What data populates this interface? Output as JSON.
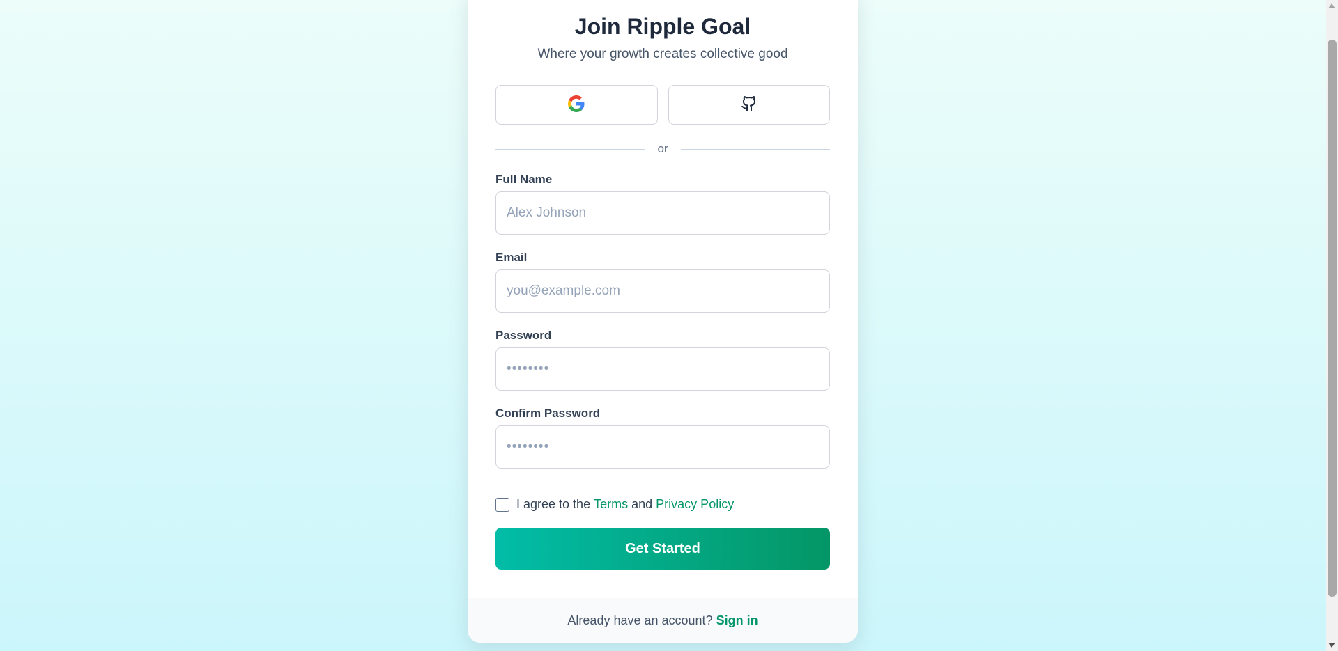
{
  "header": {
    "title": "Join Ripple Goal",
    "subtitle": "Where your growth creates collective good"
  },
  "social": {
    "google_icon": "google-icon",
    "github_icon": "github-icon",
    "divider_text": "or"
  },
  "form": {
    "full_name": {
      "label": "Full Name",
      "placeholder": "Alex Johnson",
      "value": ""
    },
    "email": {
      "label": "Email",
      "placeholder": "you@example.com",
      "value": ""
    },
    "password": {
      "label": "Password",
      "placeholder": "••••••••",
      "value": ""
    },
    "confirm_password": {
      "label": "Confirm Password",
      "placeholder": "••••••••",
      "value": ""
    },
    "agree": {
      "prefix": "I agree to the",
      "terms_link": "Terms",
      "and": "and",
      "privacy_link": "Privacy Policy",
      "checked": false
    },
    "submit_label": "Get Started"
  },
  "footer": {
    "prompt": "Already have an account?",
    "signin_link": "Sign in"
  },
  "colors": {
    "accent": "#059669",
    "button_gradient_start": "#02bda8",
    "button_gradient_end": "#049665",
    "background_top": "#ecfdfa",
    "background_bottom": "#cbf6fb"
  }
}
